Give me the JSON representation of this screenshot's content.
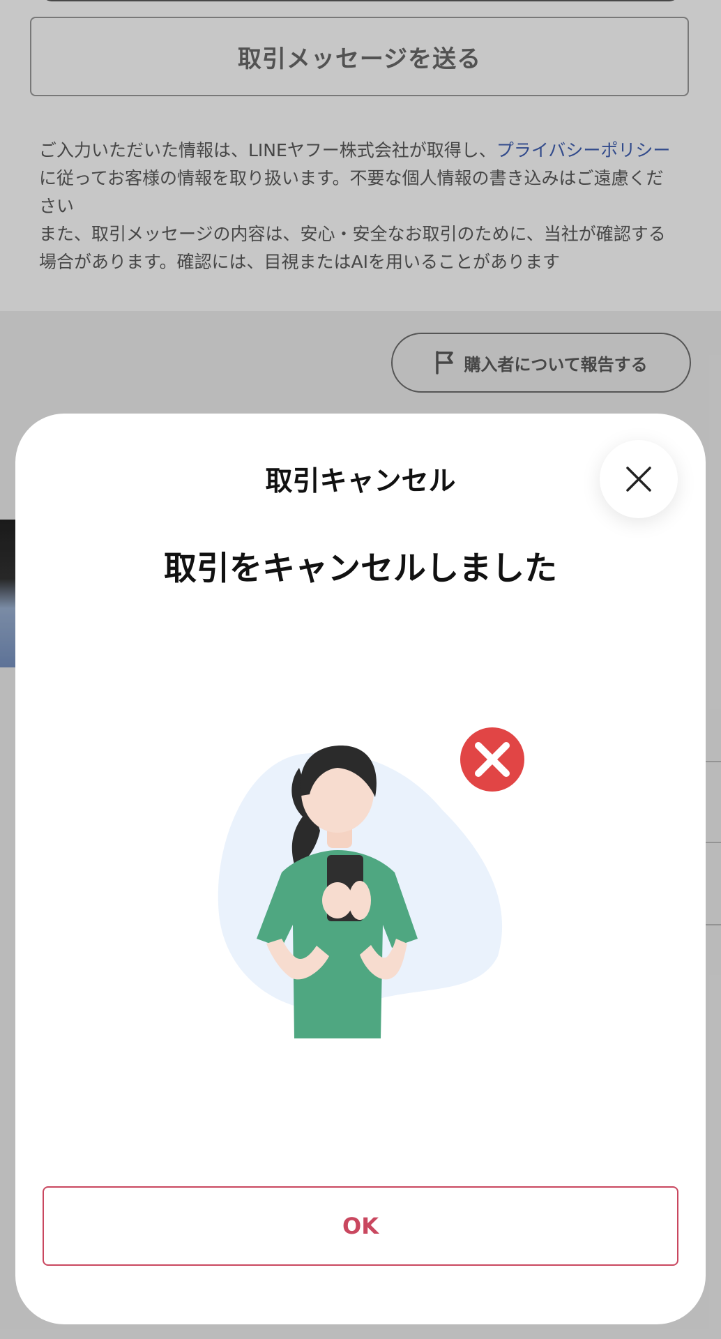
{
  "background": {
    "send_message_button": "取引メッセージを送る",
    "notice_part1": "ご入力いただいた情報は、LINEヤフー株式会社が取得し、",
    "notice_link": "プライバシーポリシー",
    "notice_part2": " に従ってお客様の情報を取り扱います。不要な個人情報の書き込みはご遠慮ください",
    "notice_part3": "また、取引メッセージの内容は、安心・安全なお取引のために、当社が確認する場合があります。確認には、目視またはAIを用いることがあります",
    "report_button": "購入者について報告する",
    "report_icon": "flag-icon"
  },
  "modal": {
    "title": "取引キャンセル",
    "close_icon": "close-icon",
    "headline": "取引をキャンセルしました",
    "illustration": "person-holding-phone-with-red-x",
    "ok_button": "OK"
  },
  "colors": {
    "link": "#3f5fb2",
    "accent_red": "#c9475f",
    "cancel_badge": "#e14545",
    "shirt_green": "#4fa781"
  }
}
